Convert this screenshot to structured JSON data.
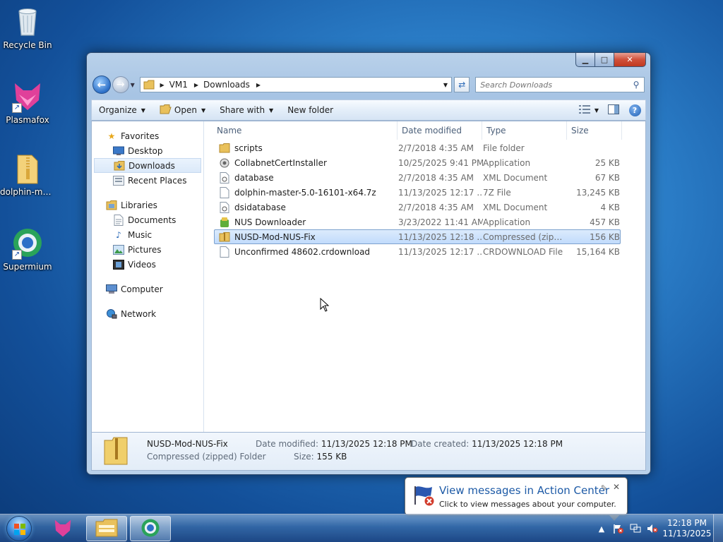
{
  "desktop": {
    "icons": [
      {
        "label": "Recycle Bin",
        "icon": "recycle-bin-icon"
      },
      {
        "label": "Plasmafox",
        "icon": "plasmafox-icon"
      },
      {
        "label": "dolphin-ma...",
        "icon": "folder-zip-icon"
      },
      {
        "label": "Supermium",
        "icon": "supermium-icon"
      }
    ]
  },
  "window": {
    "address": {
      "crumbs": [
        "VM1",
        "Downloads"
      ]
    },
    "search": {
      "placeholder": "Search Downloads"
    },
    "toolbar": {
      "organize": "Organize",
      "open": "Open",
      "share_with": "Share with",
      "new_folder": "New folder"
    },
    "nav": {
      "favorites": {
        "label": "Favorites",
        "items": [
          "Desktop",
          "Downloads",
          "Recent Places"
        ],
        "selected": "Downloads"
      },
      "libraries": {
        "label": "Libraries",
        "items": [
          "Documents",
          "Music",
          "Pictures",
          "Videos"
        ]
      },
      "computer": "Computer",
      "network": "Network"
    },
    "columns": {
      "name": "Name",
      "date": "Date modified",
      "type": "Type",
      "size": "Size"
    },
    "files": [
      {
        "name": "scripts",
        "date": "2/7/2018 4:35 AM",
        "type": "File folder",
        "size": "",
        "icon": "folder-icon"
      },
      {
        "name": "CollabnetCertInstaller",
        "date": "10/25/2025 9:41 PM",
        "type": "Application",
        "size": "25 KB",
        "icon": "application-icon"
      },
      {
        "name": "database",
        "date": "2/7/2018 4:35 AM",
        "type": "XML Document",
        "size": "67 KB",
        "icon": "xml-file-icon"
      },
      {
        "name": "dolphin-master-5.0-16101-x64.7z",
        "date": "11/13/2025 12:17 ...",
        "type": "7Z File",
        "size": "13,245 KB",
        "icon": "archive-file-icon"
      },
      {
        "name": "dsidatabase",
        "date": "2/7/2018 4:35 AM",
        "type": "XML Document",
        "size": "4 KB",
        "icon": "xml-file-icon"
      },
      {
        "name": "NUS Downloader",
        "date": "3/23/2022 11:41 AM",
        "type": "Application",
        "size": "457 KB",
        "icon": "nus-app-icon"
      },
      {
        "name": "NUSD-Mod-NUS-Fix",
        "date": "11/13/2025 12:18 ...",
        "type": "Compressed (zipp...",
        "size": "156 KB",
        "icon": "zip-folder-icon",
        "selected": true
      },
      {
        "name": "Unconfirmed 48602.crdownload",
        "date": "11/13/2025 12:17 ...",
        "type": "CRDOWNLOAD File",
        "size": "15,164 KB",
        "icon": "blank-file-icon"
      }
    ],
    "details": {
      "name": "NUSD-Mod-NUS-Fix",
      "type": "Compressed (zipped) Folder",
      "modified_label": "Date modified:",
      "modified": "11/13/2025 12:18 PM",
      "size_label": "Size:",
      "size": "155 KB",
      "created_label": "Date created:",
      "created": "11/13/2025 12:18 PM"
    }
  },
  "balloon": {
    "title": "View messages in Action Center",
    "text": "Click to view messages about your computer."
  },
  "taskbar": {
    "clock_time": "12:18 PM",
    "clock_date": "11/13/2025"
  }
}
